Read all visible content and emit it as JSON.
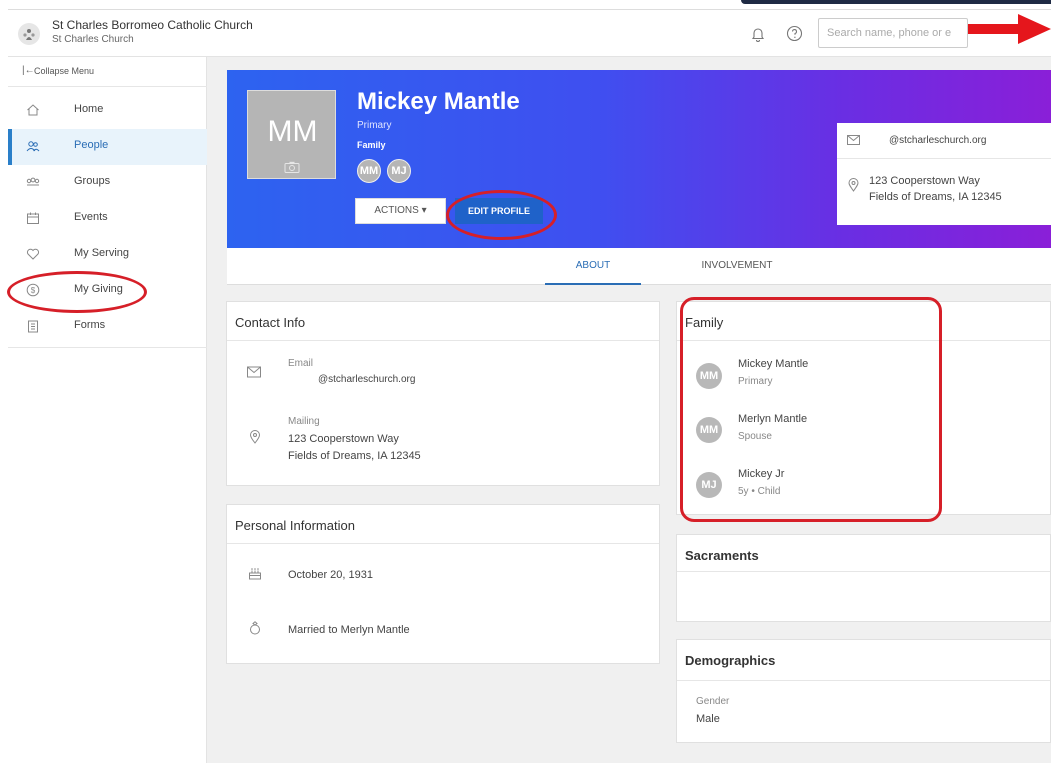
{
  "header": {
    "church_name": "St Charles Borromeo Catholic Church",
    "church_sub": "St Charles Church",
    "search_placeholder": "Search name, phone or e"
  },
  "sidebar": {
    "collapse_label": "Collapse Menu",
    "items": [
      {
        "label": "Home",
        "icon": "home-icon"
      },
      {
        "label": "People",
        "icon": "people-icon",
        "active": true
      },
      {
        "label": "Groups",
        "icon": "groups-icon"
      },
      {
        "label": "Events",
        "icon": "calendar-icon"
      },
      {
        "label": "My Serving",
        "icon": "heart-icon"
      },
      {
        "label": "My Giving",
        "icon": "dollar-icon"
      },
      {
        "label": "Forms",
        "icon": "clipboard-icon"
      }
    ]
  },
  "profile": {
    "initials": "MM",
    "name": "Mickey Mantle",
    "role": "Primary",
    "family_label": "Family",
    "family_avatars": [
      "MM",
      "MJ"
    ],
    "actions_label": "ACTIONS",
    "edit_label": "EDIT PROFILE",
    "email": "@stcharleschurch.org",
    "address_line1": "123 Cooperstown Way",
    "address_line2": "Fields of Dreams, IA 12345"
  },
  "tabs": [
    {
      "label": "ABOUT",
      "active": true
    },
    {
      "label": "INVOLVEMENT",
      "active": false
    }
  ],
  "contact_info": {
    "title": "Contact Info",
    "email_label": "Email",
    "email_value": "@stcharleschurch.org",
    "mailing_label": "Mailing",
    "mailing_line1": "123 Cooperstown Way",
    "mailing_line2": "Fields of Dreams, IA 12345"
  },
  "personal_info": {
    "title": "Personal Information",
    "birthday": "October 20, 1931",
    "marriage": "Married to Merlyn Mantle"
  },
  "family": {
    "title": "Family",
    "members": [
      {
        "initials": "MM",
        "name": "Mickey Mantle",
        "role": "Primary"
      },
      {
        "initials": "MM",
        "name": "Merlyn Mantle",
        "role": "Spouse"
      },
      {
        "initials": "MJ",
        "name": "Mickey Jr",
        "role": "5y • Child"
      }
    ]
  },
  "sacraments": {
    "title": "Sacraments"
  },
  "demographics": {
    "title": "Demographics",
    "gender_label": "Gender",
    "gender_value": "Male"
  },
  "colors": {
    "accent_blue": "#2a6db5",
    "annotation_red": "#d61f28",
    "hero_gradient_start": "#2d63f0",
    "hero_gradient_end": "#8a1fd8"
  }
}
